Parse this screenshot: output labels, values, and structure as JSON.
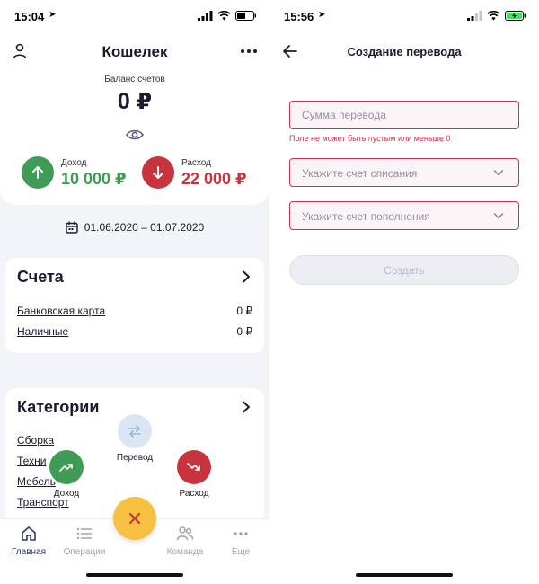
{
  "left": {
    "status": {
      "time": "15:04"
    },
    "header": {
      "title": "Кошелек"
    },
    "balance": {
      "label": "Баланс счетов",
      "value": "0 ₽"
    },
    "income": {
      "label": "Доход",
      "value": "10 000 ₽",
      "color": "#3f9b55"
    },
    "expense": {
      "label": "Расход",
      "value": "22 000 ₽",
      "color": "#c8343d"
    },
    "period": "01.06.2020 – 01.07.2020",
    "accounts": {
      "title": "Счета",
      "rows": [
        {
          "name": "Банковская карта",
          "amount": "0 ₽"
        },
        {
          "name": "Наличные",
          "amount": "0 ₽"
        }
      ]
    },
    "categories": {
      "title": "Категории",
      "rows": [
        "Сборка",
        "Техни",
        "Мебель",
        "Транспорт"
      ]
    },
    "speed_dial": {
      "transfer": "Перевод",
      "income": "Доход",
      "expense": "Расход"
    },
    "tabs": [
      {
        "label": "Главная",
        "icon": "home-icon",
        "active": true
      },
      {
        "label": "Операции",
        "icon": "list-icon",
        "active": false
      },
      {
        "label": "Команда",
        "icon": "team-icon",
        "active": false
      },
      {
        "label": "Еще",
        "icon": "more-icon",
        "active": false
      }
    ],
    "accent": "#f6c140"
  },
  "right": {
    "status": {
      "time": "15:56"
    },
    "header": {
      "title": "Создание перевода"
    },
    "amount_placeholder": "Сумма перевода",
    "amount_value": "",
    "error": "Поле не может быть пустым или меньше 0",
    "from_placeholder": "Укажите счет списания",
    "to_placeholder": "Укажите счет пополнения",
    "submit": "Создать",
    "error_color": "#c8344a"
  }
}
